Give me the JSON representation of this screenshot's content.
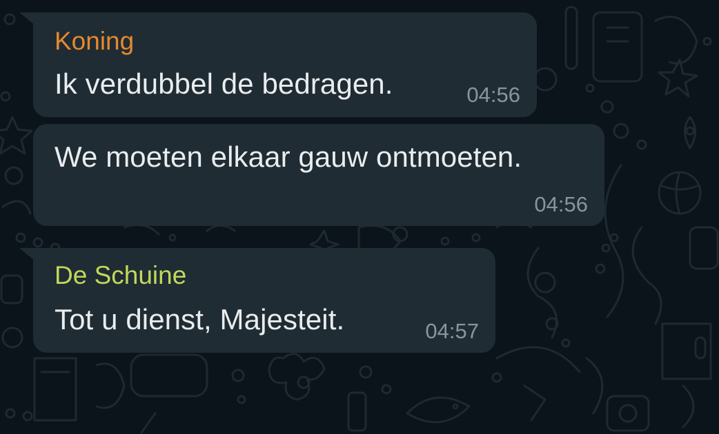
{
  "theme": {
    "background": "#0b141a",
    "bubble": "#202c33",
    "text": "#e9edef",
    "timestamp": "#8696a0"
  },
  "messages": [
    {
      "sender": "Koning",
      "sender_color": "#e5892f",
      "text": "Ik verdubbel de bedragen.",
      "time": "04:56"
    },
    {
      "text": "We moeten elkaar gauw ontmoeten.",
      "time": "04:56"
    },
    {
      "sender": "De Schuine",
      "sender_color": "#c2d85c",
      "text": "Tot u dienst, Majesteit.",
      "time": "04:57"
    }
  ]
}
